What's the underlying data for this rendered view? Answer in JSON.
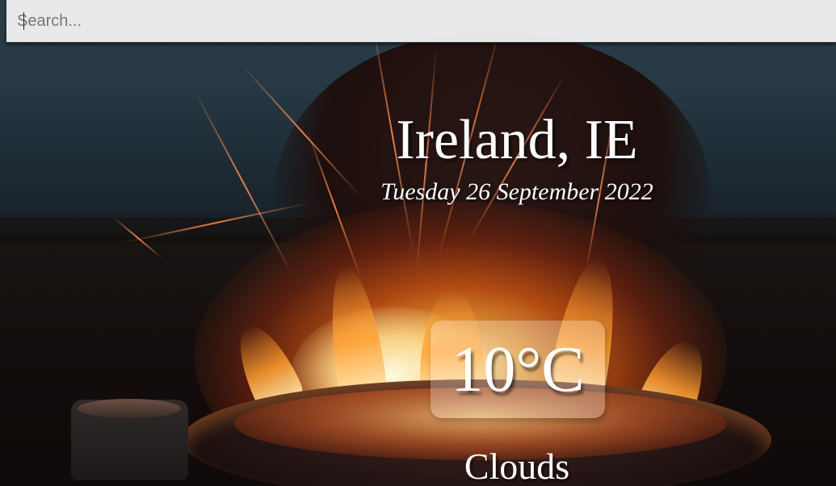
{
  "search": {
    "placeholder": "Search...",
    "value": ""
  },
  "weather": {
    "location": "Ireland, IE",
    "date": "Tuesday 26 September 2022",
    "temperature": "10°C",
    "condition": "Clouds"
  },
  "colors": {
    "text": "#ffffff",
    "search_background": "#f6f6f6"
  }
}
